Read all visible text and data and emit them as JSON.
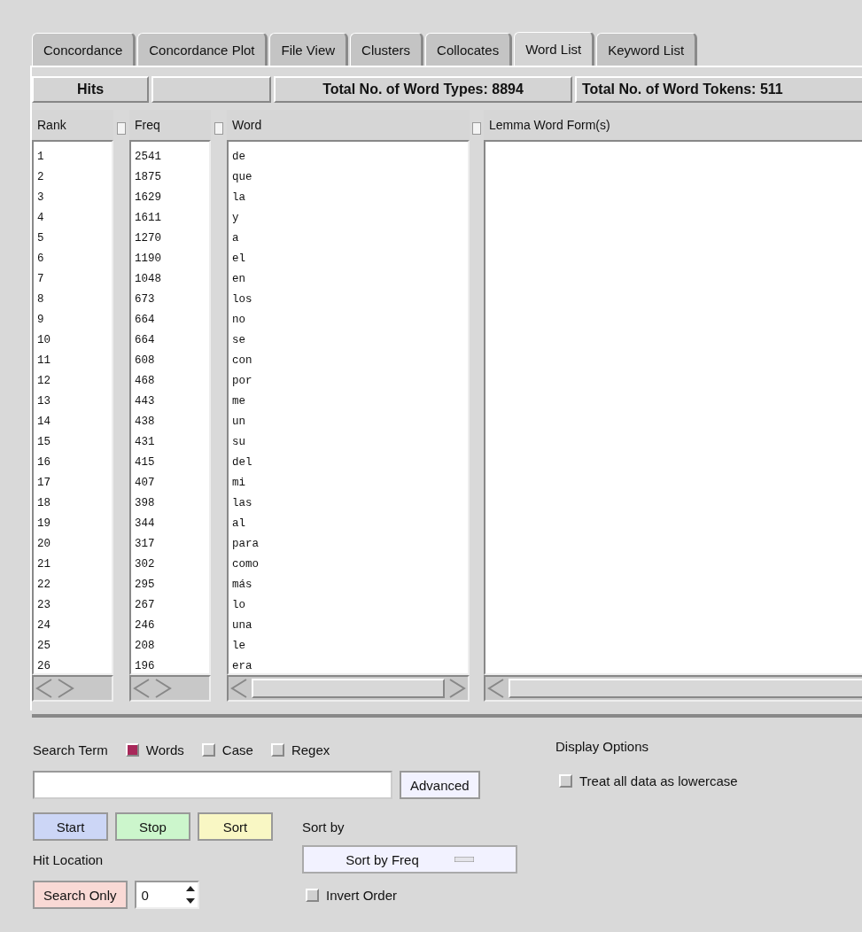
{
  "tabs": [
    {
      "label": "Concordance",
      "selected": false
    },
    {
      "label": "Concordance Plot",
      "selected": false
    },
    {
      "label": "File View",
      "selected": false
    },
    {
      "label": "Clusters",
      "selected": false
    },
    {
      "label": "Collocates",
      "selected": false
    },
    {
      "label": "Word List",
      "selected": true
    },
    {
      "label": "Keyword List",
      "selected": false
    }
  ],
  "header": {
    "hits": "Hits",
    "word_types": "Total No. of Word Types: 8894",
    "word_tokens": "Total No. of Word Tokens: 511"
  },
  "columns": [
    "Rank",
    "Freq",
    "Word",
    "Lemma Word Form(s)"
  ],
  "rows": [
    {
      "rank": "1",
      "freq": "2541",
      "word": "de"
    },
    {
      "rank": "2",
      "freq": "1875",
      "word": "que"
    },
    {
      "rank": "3",
      "freq": "1629",
      "word": "la"
    },
    {
      "rank": "4",
      "freq": "1611",
      "word": "y"
    },
    {
      "rank": "5",
      "freq": "1270",
      "word": "a"
    },
    {
      "rank": "6",
      "freq": "1190",
      "word": "el"
    },
    {
      "rank": "7",
      "freq": "1048",
      "word": "en"
    },
    {
      "rank": "8",
      "freq": "673",
      "word": "los"
    },
    {
      "rank": "9",
      "freq": "664",
      "word": "no"
    },
    {
      "rank": "10",
      "freq": "664",
      "word": "se"
    },
    {
      "rank": "11",
      "freq": "608",
      "word": "con"
    },
    {
      "rank": "12",
      "freq": "468",
      "word": "por"
    },
    {
      "rank": "13",
      "freq": "443",
      "word": "me"
    },
    {
      "rank": "14",
      "freq": "438",
      "word": "un"
    },
    {
      "rank": "15",
      "freq": "431",
      "word": "su"
    },
    {
      "rank": "16",
      "freq": "415",
      "word": "del"
    },
    {
      "rank": "17",
      "freq": "407",
      "word": "mi"
    },
    {
      "rank": "18",
      "freq": "398",
      "word": "las"
    },
    {
      "rank": "19",
      "freq": "344",
      "word": "al"
    },
    {
      "rank": "20",
      "freq": "317",
      "word": "para"
    },
    {
      "rank": "21",
      "freq": "302",
      "word": "como"
    },
    {
      "rank": "22",
      "freq": "295",
      "word": "más"
    },
    {
      "rank": "23",
      "freq": "267",
      "word": "lo"
    },
    {
      "rank": "24",
      "freq": "246",
      "word": "una"
    },
    {
      "rank": "25",
      "freq": "208",
      "word": "le"
    },
    {
      "rank": "26",
      "freq": "196",
      "word": "era"
    }
  ],
  "search": {
    "label": "Search Term",
    "options": [
      {
        "label": "Words",
        "checked": true
      },
      {
        "label": "Case",
        "checked": false
      },
      {
        "label": "Regex",
        "checked": false
      }
    ],
    "advanced": "Advanced"
  },
  "buttons": [
    {
      "label": "Start",
      "kind": "start"
    },
    {
      "label": "Stop",
      "kind": "stop"
    },
    {
      "label": "Sort",
      "kind": "sort"
    }
  ],
  "sort_by": {
    "label": "Sort by",
    "value": "Sort by Freq",
    "invert": {
      "label": "Invert Order",
      "checked": false
    }
  },
  "hit_location": {
    "label": "Hit Location",
    "button": "Search Only",
    "spinner_value": "0"
  },
  "display_options": {
    "label": "Display Options",
    "lowercase": {
      "label": "Treat all data as lowercase",
      "checked": false
    }
  }
}
